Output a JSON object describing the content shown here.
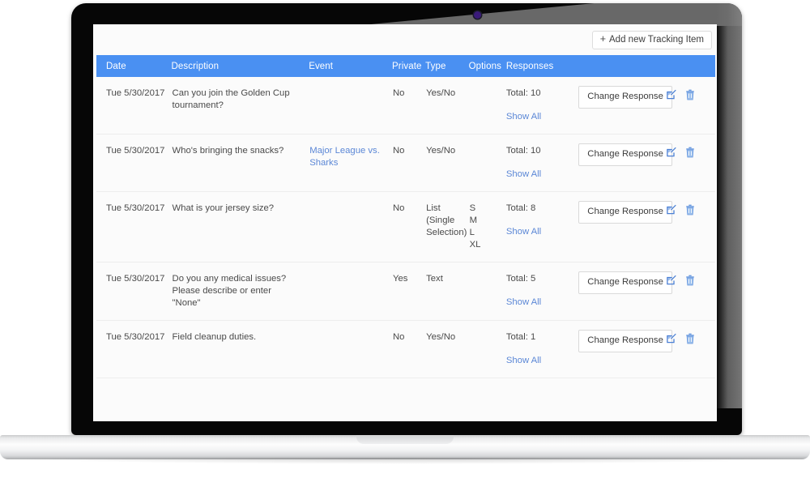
{
  "device": {
    "type": "laptop-mockup",
    "webcam_icon": "webcam-dot-icon"
  },
  "toolbar": {
    "add_button_label": "Add new Tracking Item",
    "add_button_plus": "+"
  },
  "table": {
    "accent_color": "#4a90f2",
    "link_color": "#5b87d6",
    "columns": [
      "Date",
      "Description",
      "Event",
      "Private",
      "Type",
      "Options",
      "Responses",
      "",
      ""
    ],
    "rows": [
      {
        "date": "Tue 5/30/2017",
        "description": "Can you join the Golden Cup tournament?",
        "event": "",
        "private": "No",
        "type": "Yes/No",
        "options": "",
        "total": "Total: 10",
        "show_all": "Show All",
        "action_label": "Change Response",
        "edit_icon": "edit-icon",
        "delete_icon": "trash-icon"
      },
      {
        "date": "Tue 5/30/2017",
        "description": "Who's bringing the snacks?",
        "event": "Major League vs. Sharks",
        "private": "No",
        "type": "Yes/No",
        "options": "",
        "total": "Total: 10",
        "show_all": "Show All",
        "action_label": "Change Response",
        "edit_icon": "edit-icon",
        "delete_icon": "trash-icon"
      },
      {
        "date": "Tue 5/30/2017",
        "description": "What is your jersey size?",
        "event": "",
        "private": "No",
        "type": "List (Single Selection)",
        "options": "S\nM\nL\nXL",
        "total": "Total: 8",
        "show_all": "Show All",
        "action_label": "Change Response",
        "edit_icon": "edit-icon",
        "delete_icon": "trash-icon"
      },
      {
        "date": "Tue 5/30/2017",
        "description": "Do you any medical issues? Please describe or enter \"None\"",
        "event": "",
        "private": "Yes",
        "type": "Text",
        "options": "",
        "total": "Total: 5",
        "show_all": "Show All",
        "action_label": "Change Response",
        "edit_icon": "edit-icon",
        "delete_icon": "trash-icon"
      },
      {
        "date": "Tue 5/30/2017",
        "description": "Field cleanup duties.",
        "event": "",
        "private": "No",
        "type": "Yes/No",
        "options": "",
        "total": "Total: 1",
        "show_all": "Show All",
        "action_label": "Change Response",
        "edit_icon": "edit-icon",
        "delete_icon": "trash-icon"
      }
    ]
  }
}
